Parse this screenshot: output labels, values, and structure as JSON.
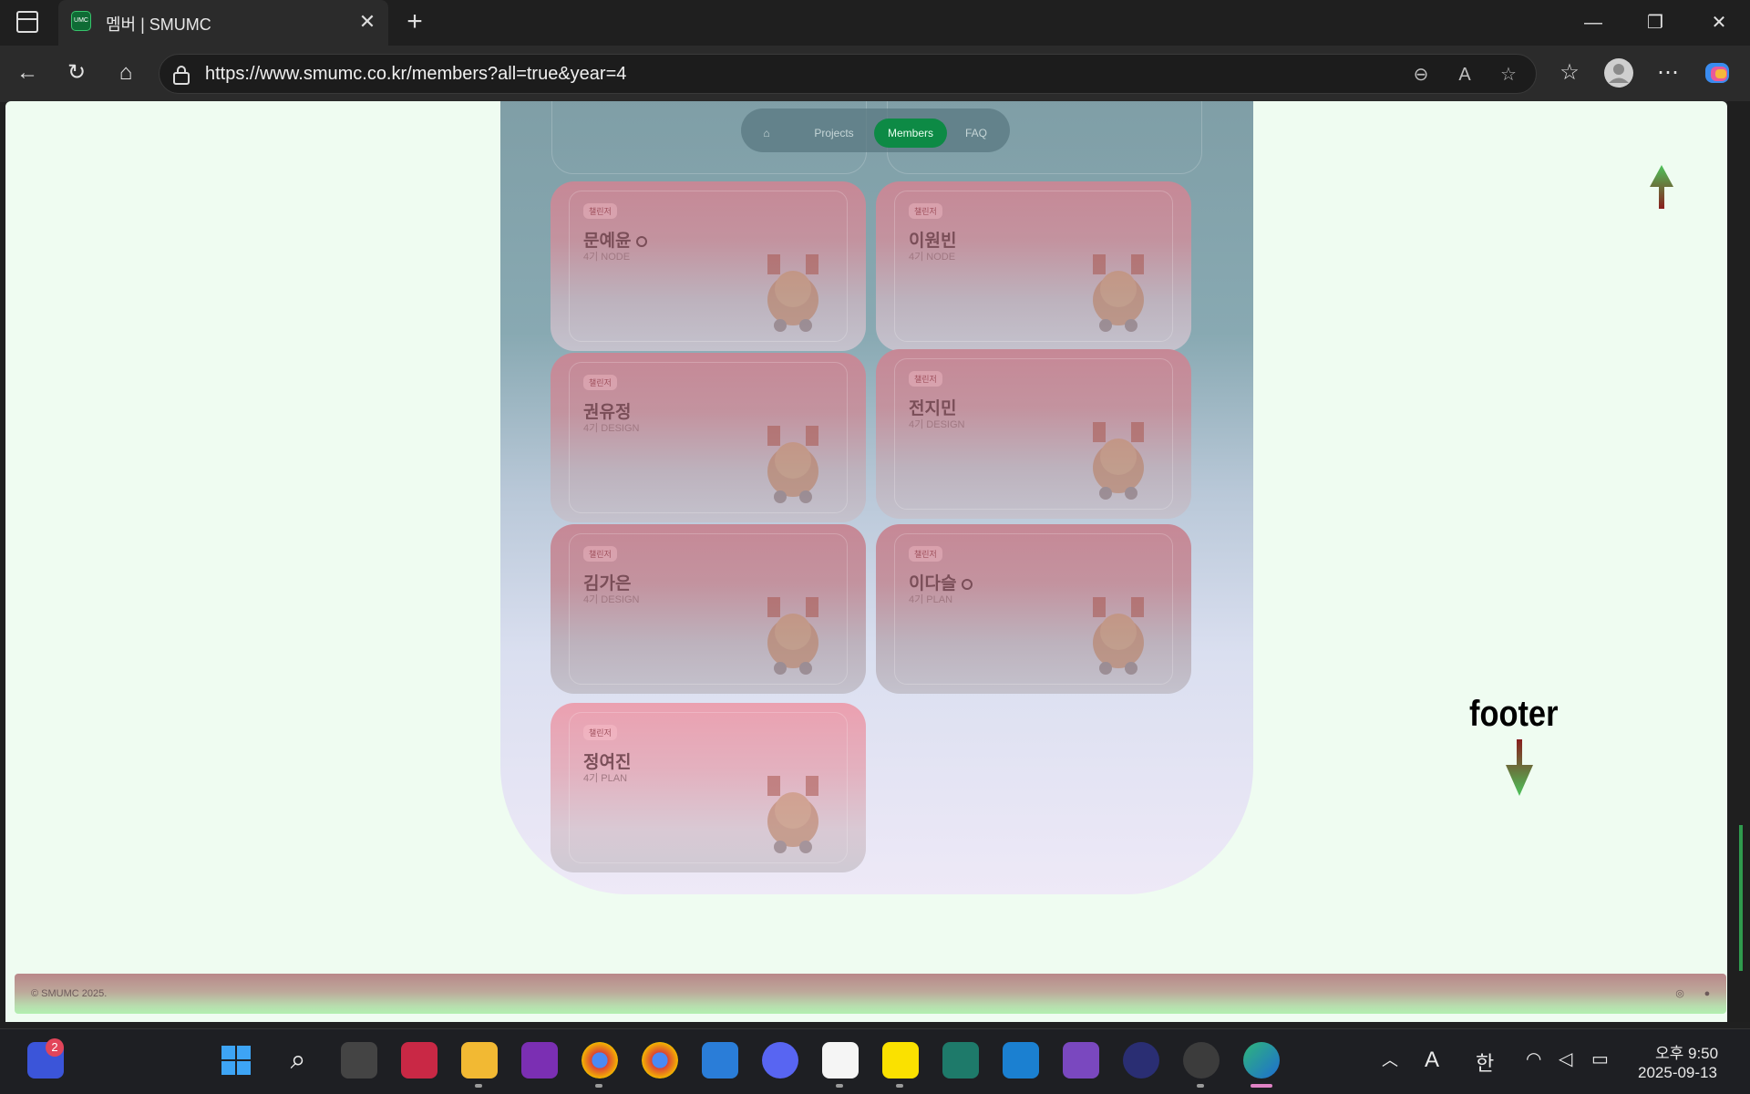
{
  "browser": {
    "tab_title": "멤버 | SMUMC",
    "favicon_text": "UMC",
    "url": "https://www.smumc.co.kr/members?all=true&year=4"
  },
  "nav": {
    "home_icon": "home-icon",
    "projects": "Projects",
    "members": "Members",
    "faq": "FAQ"
  },
  "members": [
    {
      "badge": "챌린저",
      "name": "문예윤",
      "meta": "4기 NODE",
      "github": true
    },
    {
      "badge": "챌린저",
      "name": "이원빈",
      "meta": "4기 NODE",
      "github": false
    },
    {
      "badge": "챌린저",
      "name": "권유정",
      "meta": "4기 DESIGN",
      "github": false
    },
    {
      "badge": "챌린저",
      "name": "전지민",
      "meta": "4기 DESIGN",
      "github": false
    },
    {
      "badge": "챌린저",
      "name": "김가은",
      "meta": "4기 DESIGN",
      "github": false
    },
    {
      "badge": "챌린저",
      "name": "이다슬",
      "meta": "4기 PLAN",
      "github": true
    },
    {
      "badge": "챌린저",
      "name": "정여진",
      "meta": "4기 PLAN",
      "github": false
    }
  ],
  "annotation": {
    "footer_label": "footer"
  },
  "footer": {
    "copyright": "© SMUMC 2025."
  },
  "taskbar": {
    "notification_count": "2",
    "ime_letter": "A",
    "ime_lang": "한",
    "clock_time": "오후 9:50",
    "clock_date": "2025-09-13"
  }
}
